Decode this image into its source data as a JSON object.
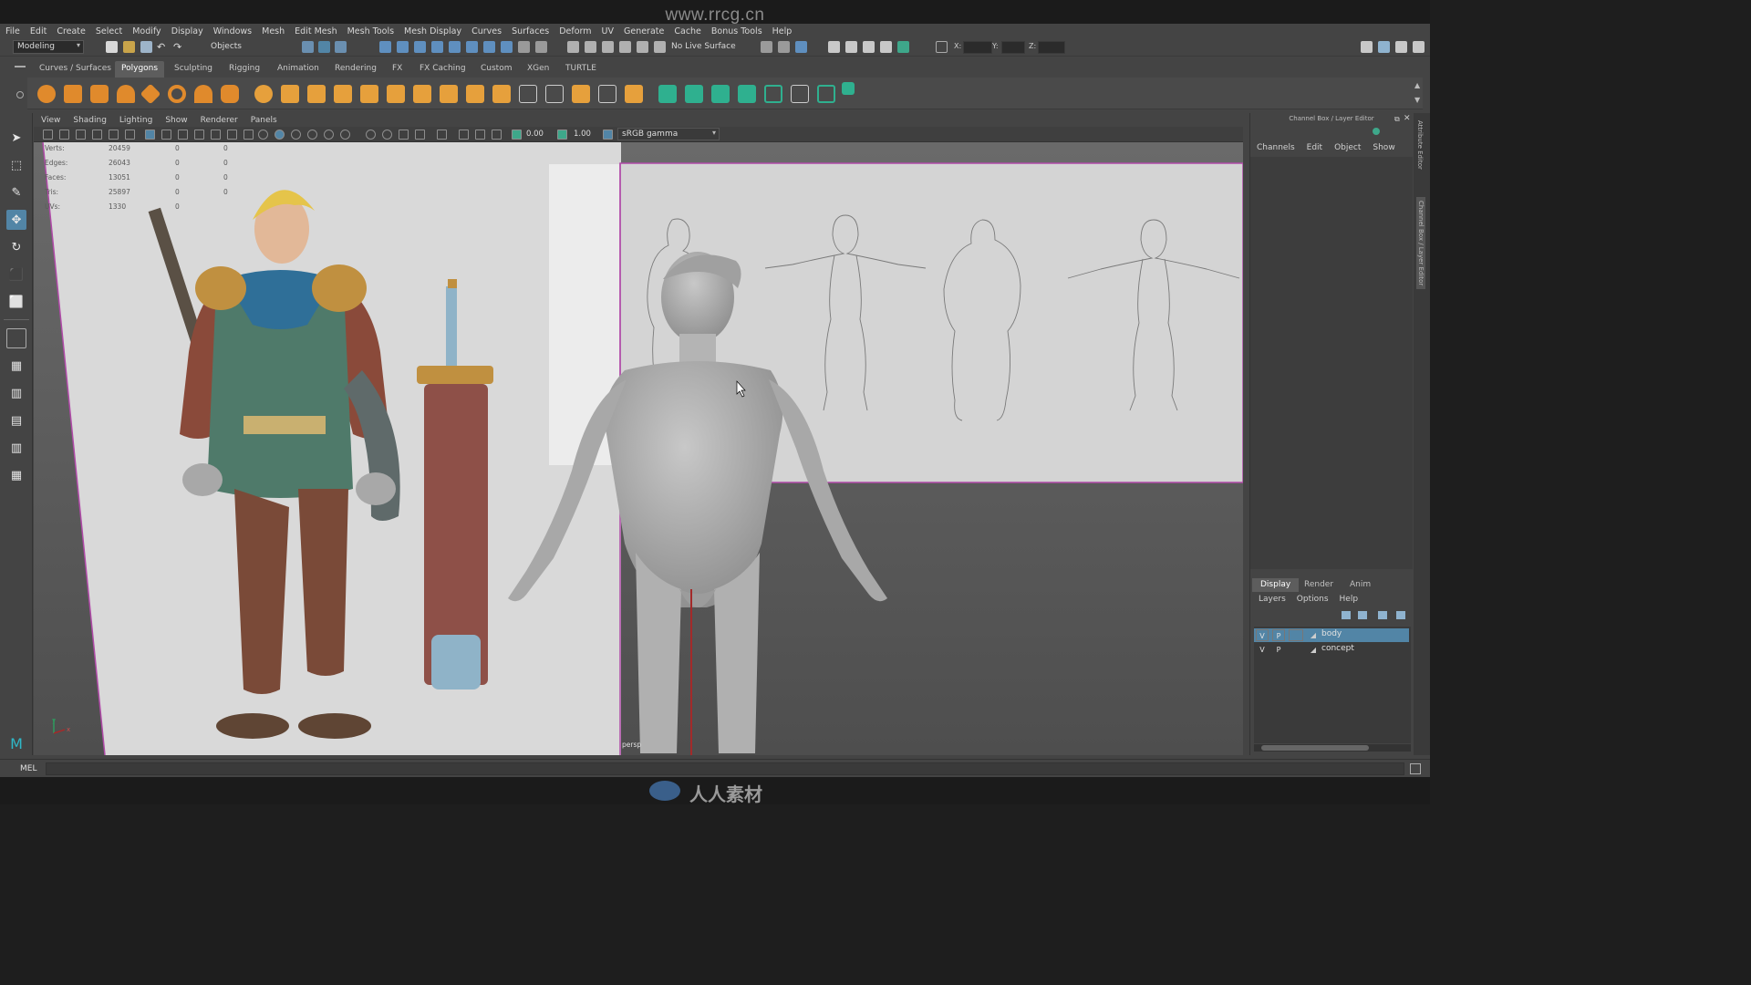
{
  "watermark": {
    "top_text": "www.rrcg.cn",
    "bottom_text": "人人素材"
  },
  "menubar": {
    "items": [
      "File",
      "Edit",
      "Create",
      "Select",
      "Modify",
      "Display",
      "Windows",
      "Mesh",
      "Edit Mesh",
      "Mesh Tools",
      "Mesh Display",
      "Curves",
      "Surfaces",
      "Deform",
      "UV",
      "Generate",
      "Cache",
      "Bonus Tools",
      "Help"
    ]
  },
  "statusline": {
    "menuset": "Modeling",
    "selection_mode": "Objects",
    "live_surface": "No Live Surface",
    "x_label": "X:",
    "y_label": "Y:",
    "z_label": "Z:"
  },
  "shelf": {
    "tabs": [
      "Curves / Surfaces",
      "Polygons",
      "Sculpting",
      "Rigging",
      "Animation",
      "Rendering",
      "FX",
      "FX Caching",
      "Custom",
      "XGen",
      "TURTLE"
    ],
    "active_tab": "Polygons"
  },
  "viewport": {
    "menu": [
      "View",
      "Shading",
      "Lighting",
      "Show",
      "Renderer",
      "Panels"
    ],
    "exposure": "0.00",
    "gamma": "1.00",
    "color_space": "sRGB gamma",
    "camera": "persp",
    "hud": [
      {
        "label": "Verts:",
        "total": "20459",
        "sel1": "0",
        "sel2": "0"
      },
      {
        "label": "Edges:",
        "total": "26043",
        "sel1": "0",
        "sel2": "0"
      },
      {
        "label": "Faces:",
        "total": "13051",
        "sel1": "0",
        "sel2": "0"
      },
      {
        "label": "Tris:",
        "total": "25897",
        "sel1": "0",
        "sel2": "0"
      },
      {
        "label": "UVs:",
        "total": "1330",
        "sel1": "0",
        "sel2": "0"
      }
    ],
    "axis": {
      "x": "x",
      "y": "y"
    }
  },
  "channelbox": {
    "title": "Channel Box / Layer Editor",
    "menu": [
      "Channels",
      "Edit",
      "Object",
      "Show"
    ]
  },
  "layer_editor": {
    "tabs": [
      "Display",
      "Render",
      "Anim"
    ],
    "active_tab": "Display",
    "menu": [
      "Layers",
      "Options",
      "Help"
    ],
    "layers": [
      {
        "v": "V",
        "p": "P",
        "name": "body",
        "selected": true
      },
      {
        "v": "V",
        "p": "P",
        "name": "concept",
        "selected": false
      }
    ]
  },
  "edge_tabs": {
    "attribute_editor": "Attribute Editor",
    "channel_box": "Channel Box / Layer Editor"
  },
  "commandline": {
    "label": "MEL"
  },
  "colors": {
    "selection_blue": "#5285a6",
    "image_plane_border": "#b04aa8",
    "y_axis": "#a32a2a"
  }
}
